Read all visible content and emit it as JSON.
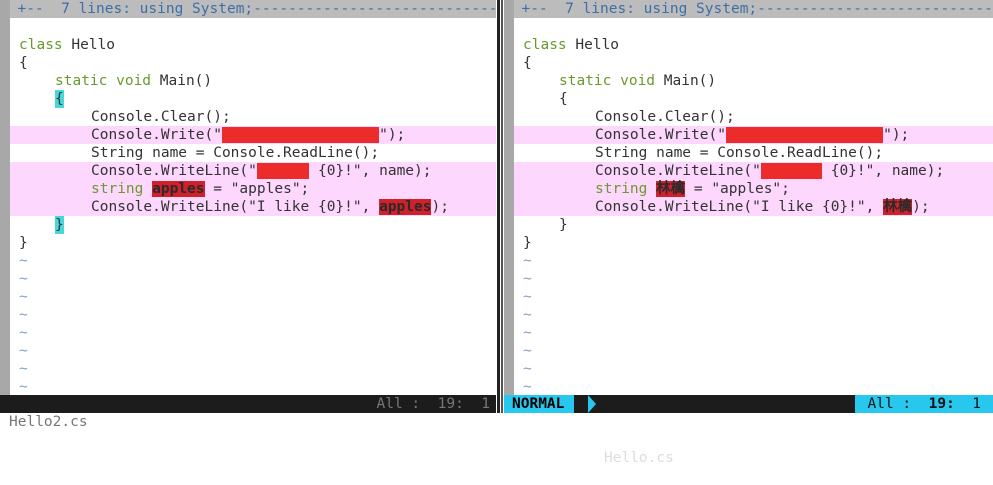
{
  "fold_text": "+ +--  7 lines: using System;",
  "fold_fill": "-------------------------------",
  "left": {
    "file": "Hello2.cs",
    "position": "All :  19:  1",
    "lines": {
      "l1a": "class",
      "l1b": " Hello",
      "l2": "{",
      "l3a": "static void",
      "l3b": " Main()",
      "l4": "{",
      "l5": "Console.Clear();",
      "l6a": "Console.Write(\"",
      "l6b": "                  ",
      "l6c": "\");",
      "l7": "String name = Console.ReadLine();",
      "l8a": "Console.WriteLine(\"",
      "l8b": "      ",
      "l8c": " {0}!\", name);",
      "l9a": "string",
      "l9b": " ",
      "l9c": "apples",
      "l9d": " = \"apples\";",
      "l10a": "Console.WriteLine(\"I like {0}!\", ",
      "l10b": "apples",
      "l10c": ");",
      "l11": "}",
      "l12": "}"
    }
  },
  "right": {
    "mode": "NORMAL",
    "file": "Hello.cs",
    "position_a": "All :  ",
    "position_b": "19:",
    "position_c": "  1",
    "lines": {
      "l1a": "class",
      "l1b": " Hello",
      "l2": "{",
      "l3a": "static void",
      "l3b": " Main()",
      "l4": "{",
      "l5": "Console.Clear();",
      "l6a": "Console.Write(\"",
      "l6b": "                  ",
      "l6c": "\");",
      "l7": "String name = Console.ReadLine();",
      "l8a": "Console.WriteLine(\"",
      "l8b": "       ",
      "l8c": " {0}!\", name);",
      "l9a": "string",
      "l9b": " ",
      "l9c": "林檎",
      "l9d": " = \"apples\";",
      "l10a": "Console.WriteLine(\"I like {0}!\", ",
      "l10b": "林檎",
      "l10c": ");",
      "l11": "}",
      "l12": "}"
    }
  },
  "tilde": "~",
  "colors": {
    "keyword": "#6a9a2c",
    "diff_change": "#fdd7fd",
    "diff_text": "#d0202a",
    "mode_bg": "#27c7ee"
  }
}
